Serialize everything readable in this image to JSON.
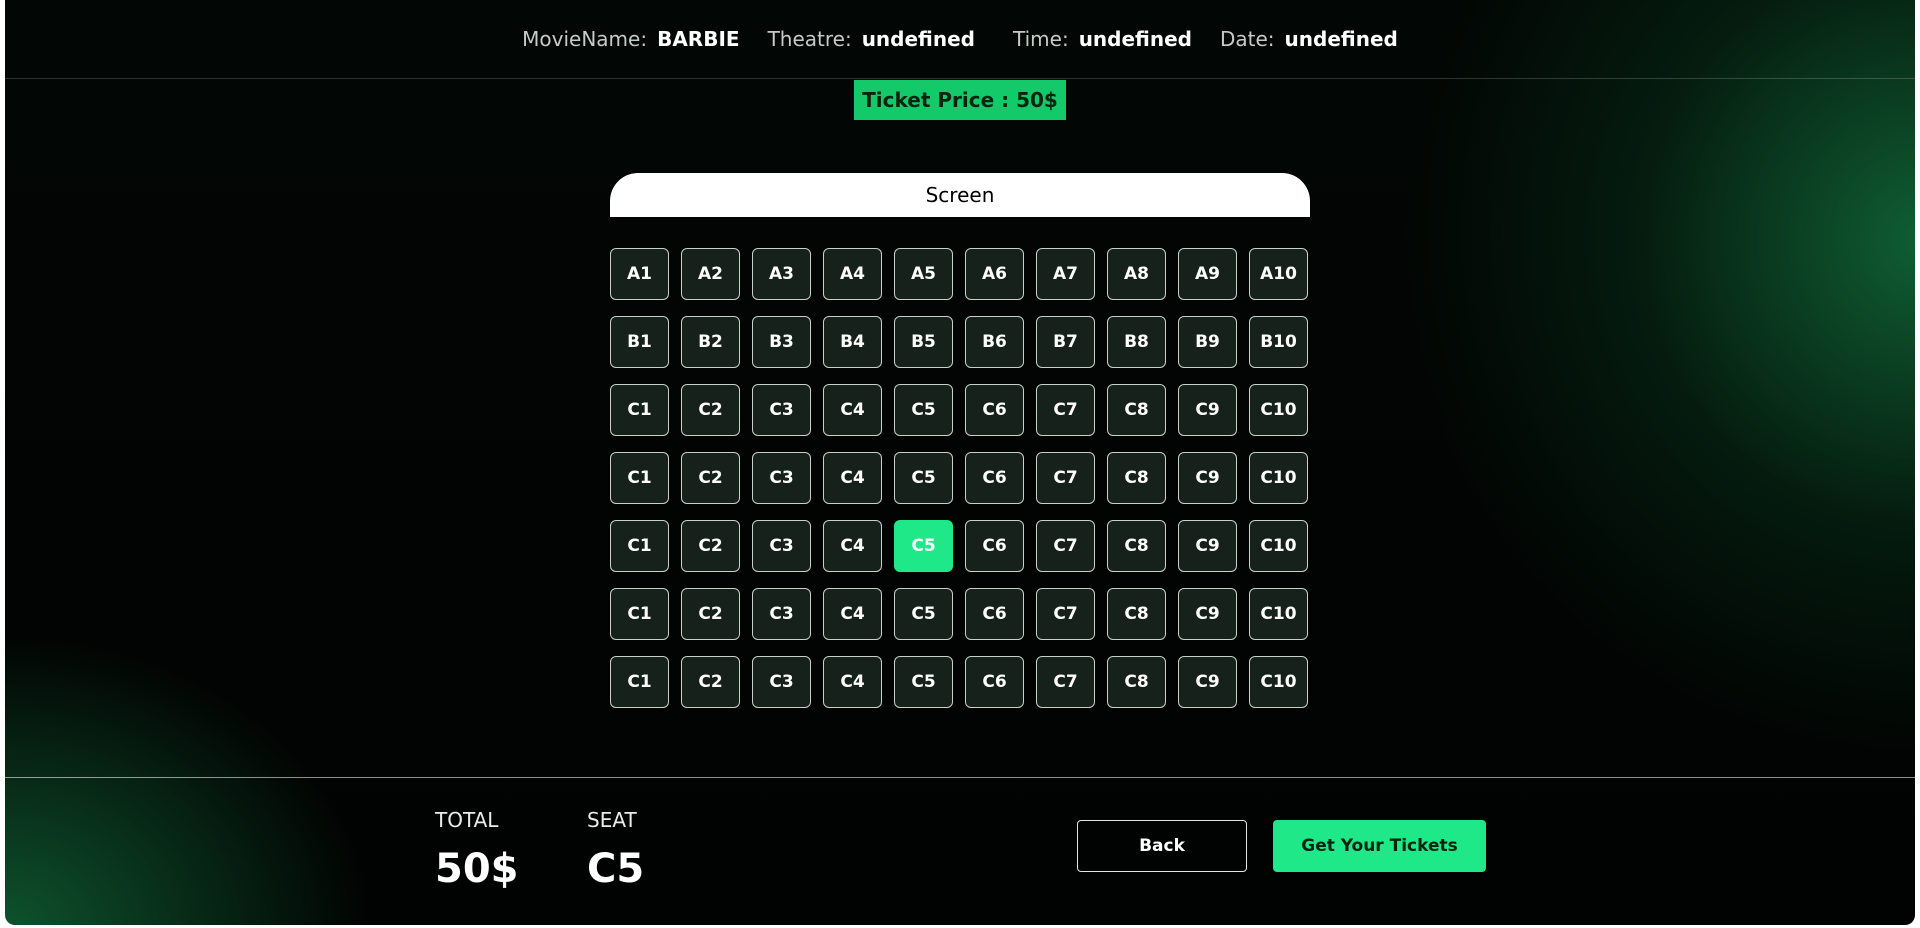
{
  "header": {
    "movie_label": "MovieName:",
    "movie_value": "BARBIE",
    "theatre_label": "Theatre:",
    "theatre_value": "undefined",
    "time_label": "Time:",
    "time_value": "undefined",
    "date_label": "Date:",
    "date_value": "undefined"
  },
  "ticket_price": "Ticket Price : 50$",
  "screen_label": "Screen",
  "seats": {
    "rows": [
      [
        "A1",
        "A2",
        "A3",
        "A4",
        "A5",
        "A6",
        "A7",
        "A8",
        "A9",
        "A10"
      ],
      [
        "B1",
        "B2",
        "B3",
        "B4",
        "B5",
        "B6",
        "B7",
        "B8",
        "B9",
        "B10"
      ],
      [
        "C1",
        "C2",
        "C3",
        "C4",
        "C5",
        "C6",
        "C7",
        "C8",
        "C9",
        "C10"
      ],
      [
        "C1",
        "C2",
        "C3",
        "C4",
        "C5",
        "C6",
        "C7",
        "C8",
        "C9",
        "C10"
      ],
      [
        "C1",
        "C2",
        "C3",
        "C4",
        "C5",
        "C6",
        "C7",
        "C8",
        "C9",
        "C10"
      ],
      [
        "C1",
        "C2",
        "C3",
        "C4",
        "C5",
        "C6",
        "C7",
        "C8",
        "C9",
        "C10"
      ],
      [
        "C1",
        "C2",
        "C3",
        "C4",
        "C5",
        "C6",
        "C7",
        "C8",
        "C9",
        "C10"
      ]
    ],
    "selected": {
      "row": 4,
      "col": 4
    }
  },
  "summary": {
    "total_label": "TOTAL",
    "total_value": "50$",
    "seat_label": "SEAT",
    "seat_value": "C5"
  },
  "actions": {
    "back_label": "Back",
    "get_tickets_label": "Get Your Tickets"
  },
  "colors": {
    "accent": "#1ee887",
    "price_badge": "#14c96a",
    "seat_bg": "#16211b"
  }
}
